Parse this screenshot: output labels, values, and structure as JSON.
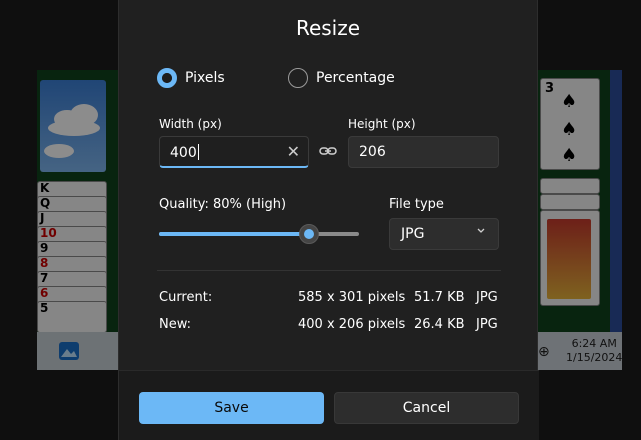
{
  "dialog": {
    "title": "Resize",
    "mode": {
      "options": [
        {
          "label": "Pixels",
          "selected": true
        },
        {
          "label": "Percentage",
          "selected": false
        }
      ]
    },
    "width": {
      "label": "Width  (px)",
      "value": "400"
    },
    "height": {
      "label": "Height  (px)",
      "value": "206"
    },
    "quality": {
      "label": "Quality: 80% (High)",
      "value_percent": 80
    },
    "file_type": {
      "label": "File type",
      "selected": "JPG"
    },
    "info": {
      "current": {
        "label": "Current:",
        "dimensions": "585 x 301 pixels",
        "size": "51.7 KB",
        "format": "JPG"
      },
      "new": {
        "label": "New:",
        "dimensions": "400 x 206 pixels",
        "size": "26.4 KB",
        "format": "JPG"
      }
    },
    "buttons": {
      "save": "Save",
      "cancel": "Cancel"
    }
  },
  "background": {
    "cards_left": [
      "K",
      "Q",
      "J",
      "10",
      "9",
      "8",
      "7",
      "6",
      "5"
    ],
    "card_right_top": "3",
    "taskbar": {
      "time": "6:24 AM",
      "date": "1/15/2024"
    }
  },
  "colors": {
    "accent": "#6cb8f6",
    "dialog_bg": "#202020",
    "field_bg": "#2d2d2d"
  },
  "icons": {
    "clear": "close-icon",
    "link": "link-icon",
    "dropdown": "chevron-down-icon"
  }
}
